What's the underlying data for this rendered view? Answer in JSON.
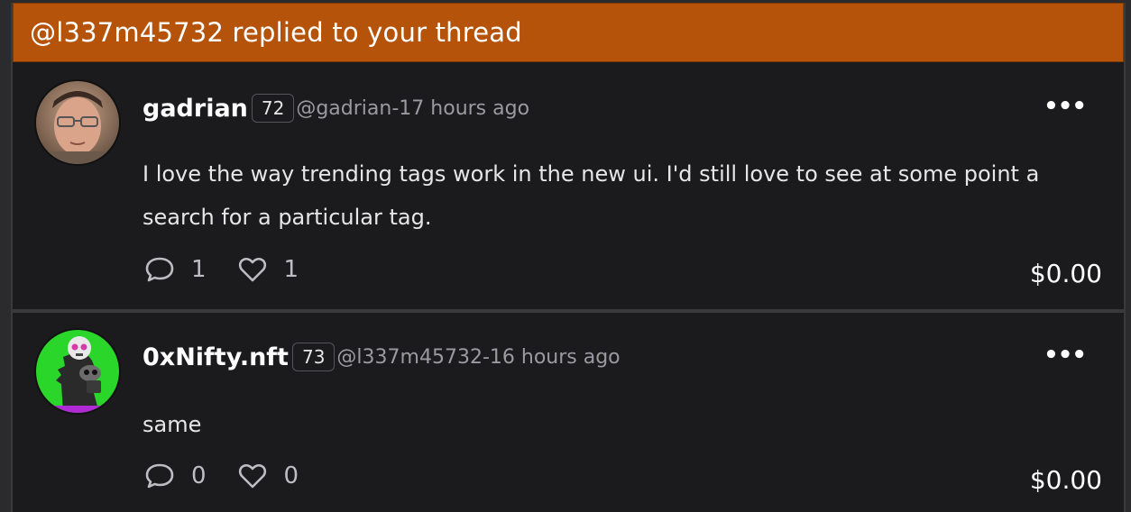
{
  "notification": {
    "title": "@l337m45732 replied to your thread"
  },
  "posts": [
    {
      "username": "gadrian",
      "reputation": "72",
      "handle": "@gadrian",
      "separator": "-",
      "time": "17 hours ago",
      "more_label": "•••",
      "body": "I love the way trending tags work in the new ui. I'd still love to see at some point a search for a particular tag.",
      "comments": "1",
      "likes": "1",
      "payout": "$0.00",
      "avatar_icon": "user-photo-avatar"
    },
    {
      "username": "0xNifty.nft",
      "reputation": "73",
      "handle": "@l337m45732",
      "separator": "-",
      "time": "16 hours ago",
      "more_label": "•••",
      "body": "same",
      "comments": "0",
      "likes": "0",
      "payout": "$0.00",
      "avatar_icon": "nft-skull-avatar"
    }
  ],
  "colors": {
    "banner": "#b5530a",
    "background": "#1b1b1e",
    "muted_text": "#9a9aa0"
  },
  "icons": {
    "comment": "speech-bubble-icon",
    "like": "heart-icon",
    "more": "ellipsis-icon"
  }
}
